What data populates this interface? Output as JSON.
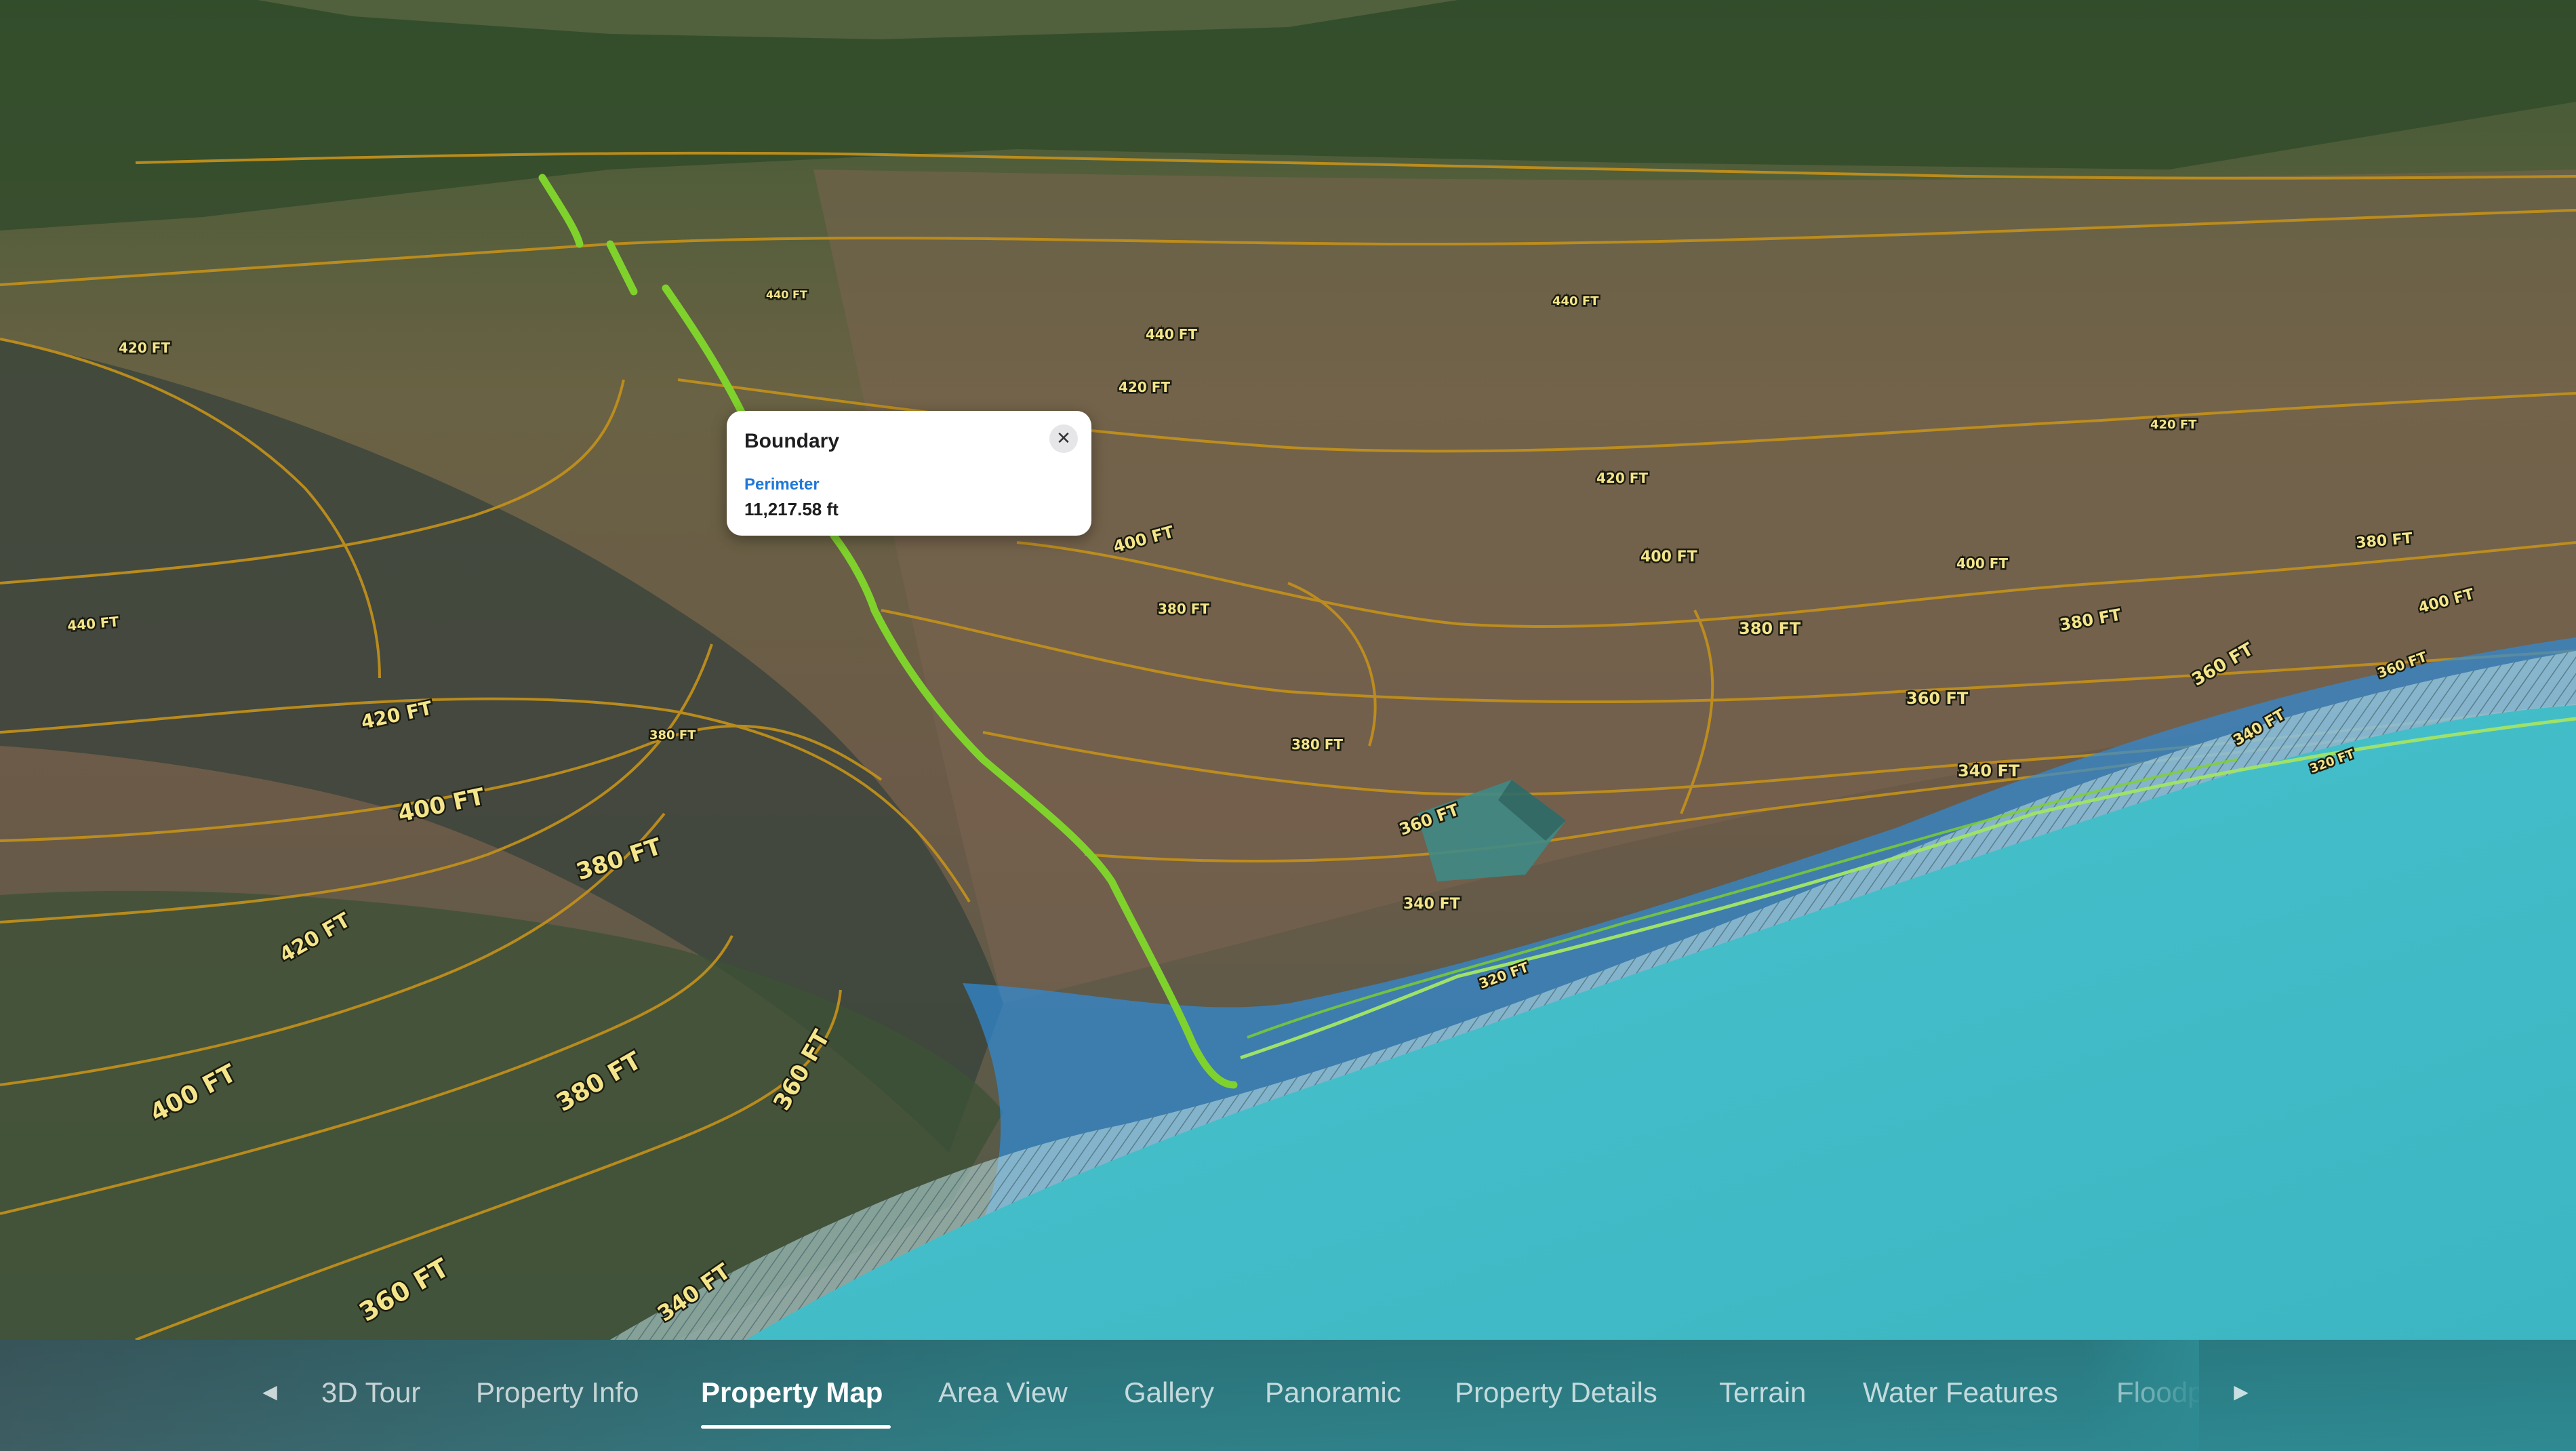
{
  "popup": {
    "title": "Boundary",
    "close_icon": "close-icon",
    "field_label": "Perimeter",
    "field_value": "11,217.58 ft"
  },
  "navigation": {
    "prev_icon": "chevron-left-icon",
    "next_icon": "chevron-right-icon",
    "tabs": [
      {
        "label": "3D Tour",
        "active": false
      },
      {
        "label": "Property Info",
        "active": false
      },
      {
        "label": "Property Map",
        "active": true
      },
      {
        "label": "Area View",
        "active": false
      },
      {
        "label": "Gallery",
        "active": false
      },
      {
        "label": "Panoramic",
        "active": false
      },
      {
        "label": "Property Details",
        "active": false
      },
      {
        "label": "Terrain",
        "active": false
      },
      {
        "label": "Water Features",
        "active": false
      },
      {
        "label": "Floodplain",
        "active": false
      }
    ]
  },
  "map": {
    "contour_labels": [
      "420 FT",
      "440 FT",
      "400 FT",
      "380 FT",
      "360 FT",
      "340 FT",
      "320 FT"
    ],
    "colors": {
      "boundary_line": "#7fd22c",
      "contour_line": "#c08f1c",
      "water": "#43bcc8",
      "floodplain": "#2f8bd8"
    }
  }
}
